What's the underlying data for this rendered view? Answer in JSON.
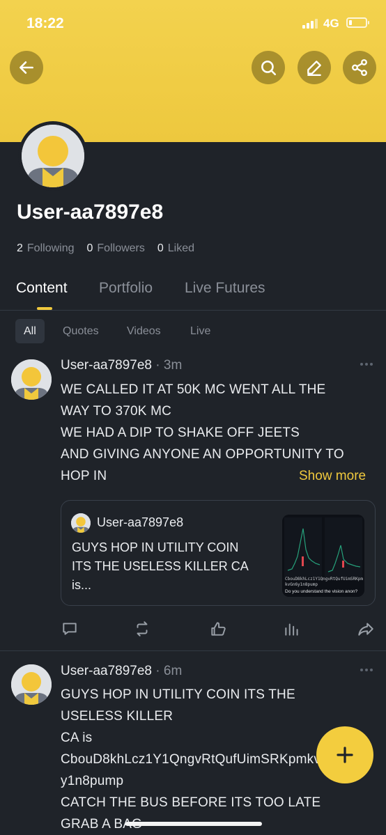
{
  "status_bar": {
    "time": "18:22",
    "network": "4G"
  },
  "profile": {
    "username": "User-aa7897e8",
    "stats": [
      {
        "count": "2",
        "label": "Following"
      },
      {
        "count": "0",
        "label": "Followers"
      },
      {
        "count": "0",
        "label": "Liked"
      }
    ]
  },
  "tabs": [
    {
      "label": "Content",
      "active": true
    },
    {
      "label": "Portfolio",
      "active": false
    },
    {
      "label": "Live Futures",
      "active": false
    }
  ],
  "filters": [
    {
      "label": "All",
      "active": true
    },
    {
      "label": "Quotes",
      "active": false
    },
    {
      "label": "Videos",
      "active": false
    },
    {
      "label": "Live",
      "active": false
    }
  ],
  "posts": [
    {
      "author": "User-aa7897e8",
      "time": "· 3m",
      "lines": [
        "WE CALLED IT AT 50K MC WENT ALL THE",
        "WAY TO 370K MC",
        "WE HAD A DIP TO SHAKE OFF JEETS",
        "AND GIVING ANYONE AN OPPORTUNITY TO",
        "HOP IN"
      ],
      "show_more": "Show more",
      "quote": {
        "author": "User-aa7897e8",
        "lines": [
          "GUYS HOP IN UTILITY COIN",
          "ITS THE USELESS KILLER CA",
          "is..."
        ],
        "thumb_caption": "CbouD8khLcz1Y1QngvRtQufUimSRKpmkvGn6y1n8pump",
        "thumb_sub": "Do you understand the vision anon?"
      }
    },
    {
      "author": "User-aa7897e8",
      "time": "· 6m",
      "lines": [
        "GUYS HOP IN UTILITY COIN ITS THE",
        "USELESS KILLER",
        "CA is",
        "CbouD8khLcz1Y1QngvRtQufUimSRKpmkvGn6",
        "y1n8pump",
        "CATCH THE BUS BEFORE ITS TOO LATE",
        "GRAB A BAG"
      ]
    }
  ],
  "colors": {
    "accent": "#f0c93d",
    "background": "#1f2329",
    "header": "#f3d24e"
  }
}
